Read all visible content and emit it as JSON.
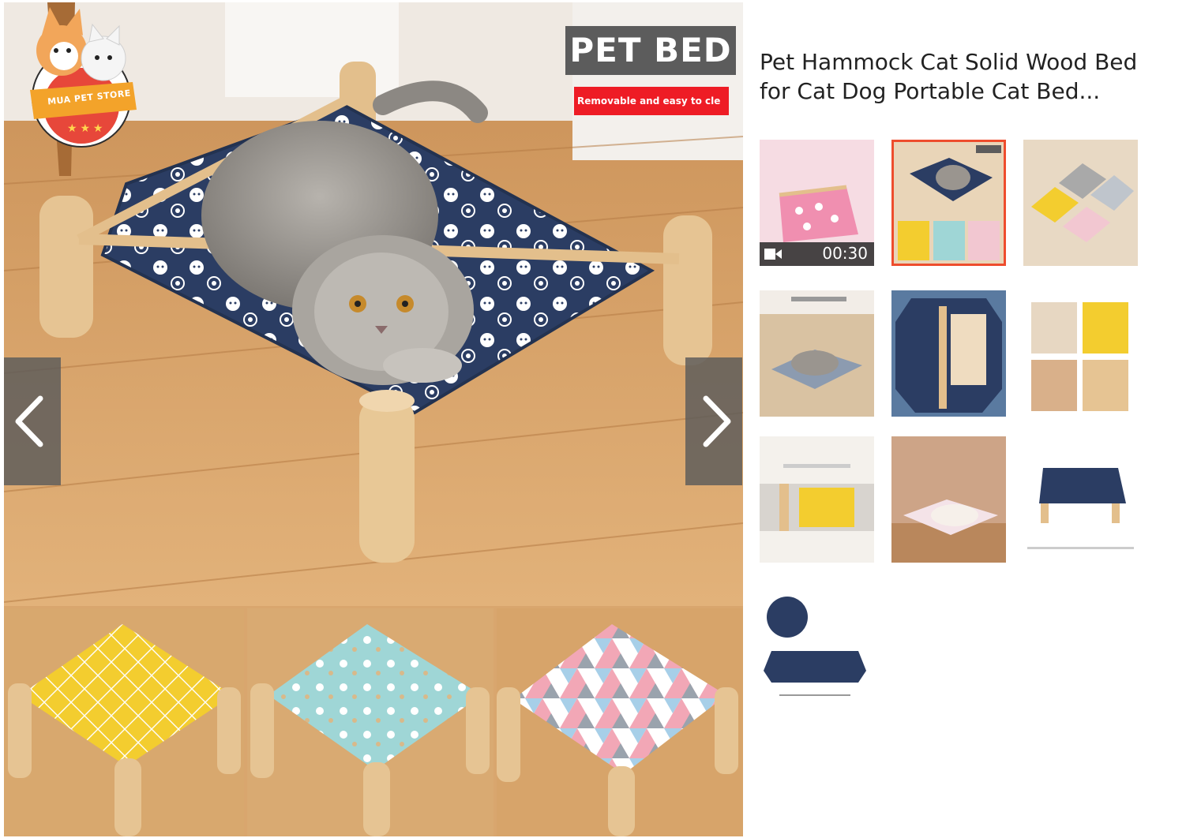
{
  "main_image": {
    "badge_title": "PET BED",
    "badge_subtitle": "Removable and easy to cle",
    "logo_text": "MUA PET STORE",
    "prev_icon": "chevron-left-icon",
    "next_icon": "chevron-right-icon"
  },
  "product": {
    "title": "Pet Hammock Cat Solid Wood Bed for Cat Dog Portable Cat Bed..."
  },
  "thumbnails": [
    {
      "kind": "video",
      "duration": "00:30",
      "selected": false
    },
    {
      "kind": "image",
      "selected": true
    },
    {
      "kind": "image",
      "selected": false
    },
    {
      "kind": "image",
      "selected": false
    },
    {
      "kind": "image",
      "selected": false
    },
    {
      "kind": "image",
      "selected": false
    },
    {
      "kind": "image",
      "selected": false
    },
    {
      "kind": "image",
      "selected": false
    },
    {
      "kind": "image",
      "selected": false
    },
    {
      "kind": "image",
      "selected": false
    }
  ],
  "colors": {
    "accent": "#ee4d2d",
    "badge_red": "#ee1c25",
    "badge_gray": "#5c5c5c",
    "fabric_navy": "#2b3d63",
    "fabric_yellow": "#f3cd2f",
    "fabric_mint": "#9fd6d6",
    "wood": "#e3bf8c"
  }
}
